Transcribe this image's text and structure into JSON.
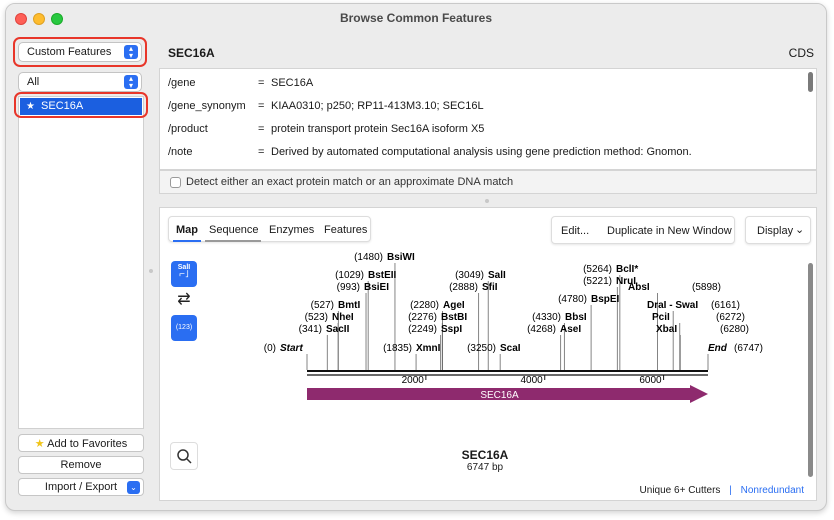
{
  "window": {
    "title": "Browse Common Features"
  },
  "sidebar": {
    "collection_popup": "Custom Features",
    "filter_popup": "All",
    "items": [
      {
        "label": "SEC16A",
        "icon": "star-icon"
      }
    ],
    "add_favorites": "Add to Favorites",
    "remove": "Remove",
    "import_export": "Import / Export"
  },
  "feature": {
    "name": "SEC16A",
    "type": "CDS",
    "qualifiers": [
      {
        "key": "/gene",
        "value": "SEC16A"
      },
      {
        "key": "/gene_synonym",
        "value": "KIAA0310; p250; RP11-413M3.10; SEC16L"
      },
      {
        "key": "/product",
        "value": "protein transport protein Sec16A isoform X5"
      },
      {
        "key": "/note",
        "value": "Derived by automated computational analysis using gene prediction method: Gnomon."
      }
    ],
    "equals": "=",
    "match_label": "Detect either an exact protein match or an approximate DNA match"
  },
  "map_view": {
    "tabs": [
      "Map",
      "Sequence",
      "Enzymes",
      "Features"
    ],
    "active_tab": "Map",
    "edit_button": "Edit...",
    "duplicate_button": "Duplicate in New Window",
    "display_button": "Display",
    "tool_sal": "SalI",
    "tool_num": "(123)",
    "sequence_name": "SEC16A",
    "sequence_length": "6747 bp",
    "feature_arrow_label": "SEC16A",
    "status_cutters": "Unique 6+ Cutters",
    "status_sep": "|",
    "status_nonredundant": "Nonredundant",
    "accent_color": "#2a6ef2",
    "feature_color": "#8e2a6e"
  },
  "chart_data": {
    "type": "restriction-map",
    "length": 6747,
    "ticks": [
      2000,
      4000,
      6000
    ],
    "tick_labels": [
      "2000",
      "4000",
      "6000"
    ],
    "ends": [
      {
        "name": "Start",
        "pos": 0,
        "label": "(0)"
      },
      {
        "name": "End",
        "pos": 6747,
        "label": "(6747)"
      }
    ],
    "sites": [
      {
        "name": "BsiWI",
        "pos": 1480,
        "label": "(1480)"
      },
      {
        "name": "BstEII",
        "pos": 1029,
        "label": "(1029)"
      },
      {
        "name": "BsiEI",
        "pos": 993,
        "label": "(993)"
      },
      {
        "name": "BmtI",
        "pos": 527,
        "label": "(527)"
      },
      {
        "name": "NheI",
        "pos": 523,
        "label": "(523)"
      },
      {
        "name": "SacII",
        "pos": 341,
        "label": "(341)"
      },
      {
        "name": "AgeI",
        "pos": 2280,
        "label": "(2280)"
      },
      {
        "name": "BstBI",
        "pos": 2276,
        "label": "(2276)"
      },
      {
        "name": "SspI",
        "pos": 2249,
        "label": "(2249)"
      },
      {
        "name": "XmnI",
        "pos": 1835,
        "label": "(1835)"
      },
      {
        "name": "SalI",
        "pos": 3049,
        "label": "(3049)"
      },
      {
        "name": "SfiI",
        "pos": 2888,
        "label": "(2888)"
      },
      {
        "name": "ScaI",
        "pos": 3250,
        "label": "(3250)"
      },
      {
        "name": "BclI*",
        "pos": 5264,
        "label": "(5264)"
      },
      {
        "name": "NruI",
        "pos": 5221,
        "label": "(5221)"
      },
      {
        "name": "BspEI",
        "pos": 4780,
        "label": "(4780)"
      },
      {
        "name": "BbsI",
        "pos": 4330,
        "label": "(4330)"
      },
      {
        "name": "AseI",
        "pos": 4268,
        "label": "(4268)"
      },
      {
        "name": "AbsI",
        "pos": 5898,
        "label": "(5898)"
      },
      {
        "name": "DraI - SwaI",
        "pos": 6161,
        "label": "(6161)"
      },
      {
        "name": "PciI",
        "pos": 6272,
        "label": "(6272)"
      },
      {
        "name": "XbaI",
        "pos": 6280,
        "label": "(6280)"
      }
    ],
    "features": [
      {
        "name": "SEC16A",
        "start": 0,
        "end": 6747,
        "direction": "forward"
      }
    ]
  }
}
